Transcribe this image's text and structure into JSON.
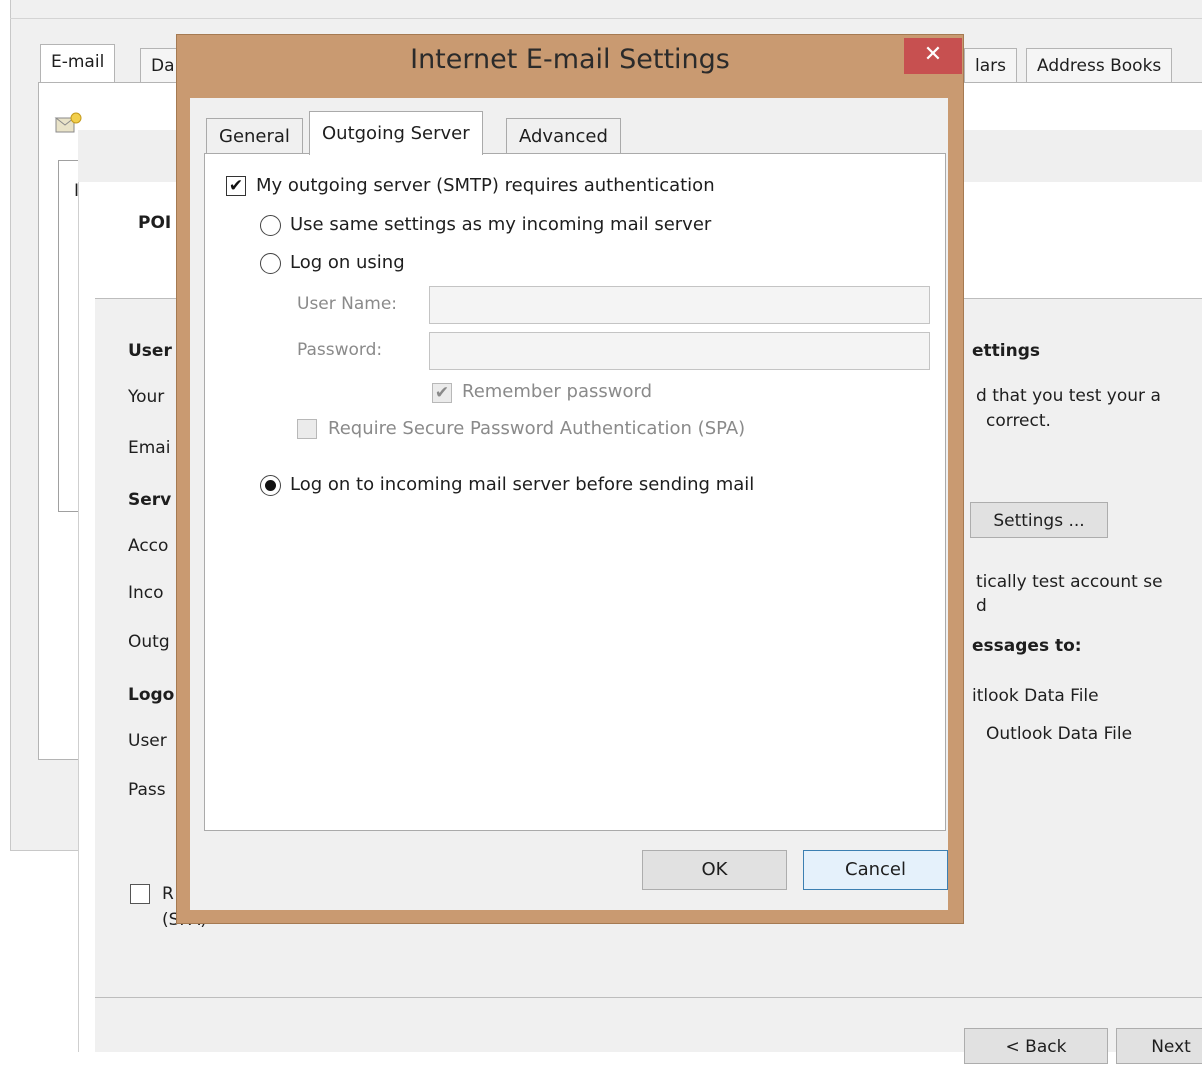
{
  "background_window": {
    "tabs": [
      "E-mail",
      "Da",
      "lars",
      "Address Books"
    ],
    "list_column": "I"
  },
  "wizard": {
    "header_title": "POI",
    "left_labels": {
      "user_info": "User",
      "your_name": "Your",
      "email": "Emai",
      "server_info": "Serv",
      "account_type": "Acco",
      "incoming": "Inco",
      "outgoing": "Outg",
      "logon_info": "Logo",
      "username": "User",
      "password": "Pass",
      "spa_r": "R",
      "spa_paren": "(SPA)"
    },
    "right_texts": {
      "test_settings": "ettings",
      "recommend": "d that you test your a",
      "correct": "correct.",
      "auto_test": "tically test account se",
      "auto_test2": "d",
      "deliver": "essages to:",
      "new_file": "itlook Data File",
      "existing_file": "Outlook Data File"
    },
    "test_button": "Settings ...",
    "back_button": "< Back",
    "next_button": "Next"
  },
  "dialog": {
    "title": "Internet E-mail Settings",
    "close_glyph": "✕",
    "tabs": [
      "General",
      "Outgoing Server",
      "Advanced"
    ],
    "active_tab": "Outgoing Server",
    "requires_auth": {
      "label": "My outgoing server (SMTP) requires authentication",
      "checked": true
    },
    "same_settings": {
      "label": "Use same settings as my incoming mail server",
      "selected": false
    },
    "log_on_using": {
      "label": "Log on using",
      "selected": false
    },
    "user_name": {
      "label": "User Name:",
      "value": ""
    },
    "password": {
      "label": "Password:",
      "value": ""
    },
    "remember_password": {
      "label": "Remember password",
      "checked": true
    },
    "require_spa": {
      "label": "Require Secure Password Authentication (SPA)",
      "checked": false
    },
    "log_on_incoming": {
      "label": "Log on to incoming mail server before sending mail",
      "selected": true
    },
    "ok_button": "OK",
    "cancel_button": "Cancel",
    "check_glyph": "✔"
  },
  "colors": {
    "dialog_frame": "#c99a71",
    "close_button": "#c75050",
    "disabled_text": "#8a8a8a"
  }
}
